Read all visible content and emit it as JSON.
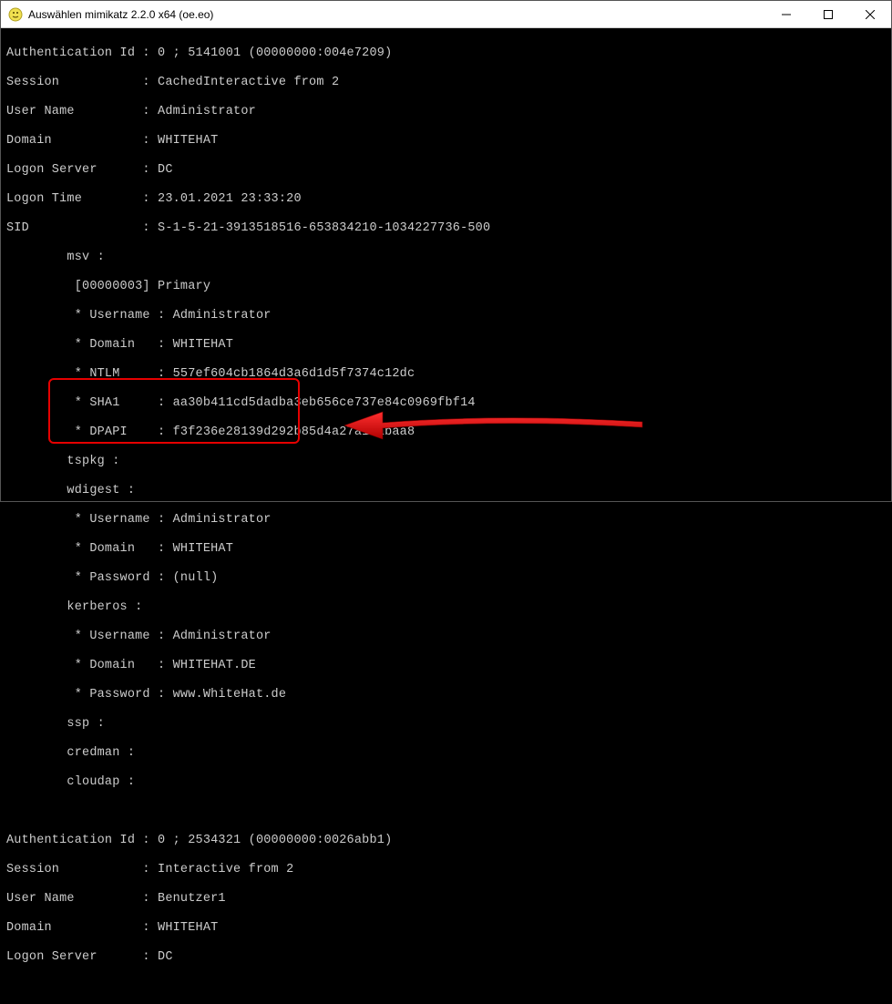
{
  "window": {
    "title": "Auswählen mimikatz 2.2.0 x64 (oe.eo)"
  },
  "block1": {
    "auth_id": "Authentication Id : 0 ; 5141001 (00000000:004e7209)",
    "session": "Session           : CachedInteractive from 2",
    "username": "User Name         : Administrator",
    "domain": "Domain            : WHITEHAT",
    "logon_server": "Logon Server      : DC",
    "logon_time": "Logon Time        : 23.01.2021 23:33:20",
    "sid": "SID               : S-1-5-21-3913518516-653834210-1034227736-500",
    "msv_header": "        msv :",
    "msv_primary": "         [00000003] Primary",
    "msv_user": "         * Username : Administrator",
    "msv_domain": "         * Domain   : WHITEHAT",
    "msv_ntlm": "         * NTLM     : 557ef604cb1864d3a6d1d5f7374c12dc",
    "msv_sha1": "         * SHA1     : aa30b411cd5dadba3eb656ce737e84c0969fbf14",
    "msv_dpapi": "         * DPAPI    : f3f236e28139d292b85d4a27a14abaa8",
    "tspkg": "        tspkg :",
    "wdigest_header": "        wdigest :",
    "wdigest_user": "         * Username : Administrator",
    "wdigest_domain": "         * Domain   : WHITEHAT",
    "wdigest_pass": "         * Password : (null)",
    "kerberos_header": "        kerberos :",
    "kerberos_user": "         * Username : Administrator",
    "kerberos_domain": "         * Domain   : WHITEHAT.DE",
    "kerberos_pass": "         * Password : www.WhiteHat.de",
    "ssp": "        ssp :",
    "credman": "        credman :",
    "cloudap": "        cloudap :"
  },
  "block2": {
    "auth_id": "Authentication Id : 0 ; 2534321 (00000000:0026abb1)",
    "session": "Session           : Interactive from 2",
    "username": "User Name         : Benutzer1",
    "domain": "Domain            : WHITEHAT",
    "logon_server": "Logon Server      : DC"
  }
}
